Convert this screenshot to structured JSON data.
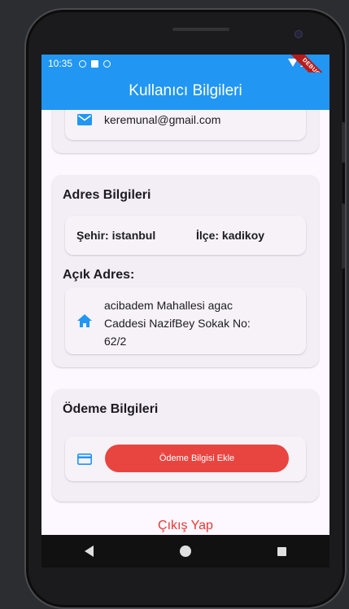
{
  "status_bar": {
    "time": "10:35",
    "debug_label": "DEBUG"
  },
  "app_bar": {
    "title": "Kullanıcı Bilgileri"
  },
  "contact": {
    "email": "keremunal@gmail.com",
    "email_icon": "mail-icon"
  },
  "address": {
    "title": "Adres Bilgileri",
    "city_label": "Şehir: istanbul",
    "district_label": "İlçe: kadikoy",
    "open_address_title": "Açık Adres:",
    "open_address_lines": [
      "acibadem Mahallesi agac",
      "Caddesi NazifBey Sokak No:",
      "62/2"
    ],
    "home_icon": "home-icon"
  },
  "payment": {
    "title": "Ödeme Bilgileri",
    "add_button": "Ödeme Bilgisi Ekle",
    "card_icon": "credit-card-icon"
  },
  "logout": {
    "label": "Çıkış Yap"
  },
  "colors": {
    "primary": "#2196f3",
    "danger": "#e84540",
    "card_bg": "#f3edf6"
  }
}
